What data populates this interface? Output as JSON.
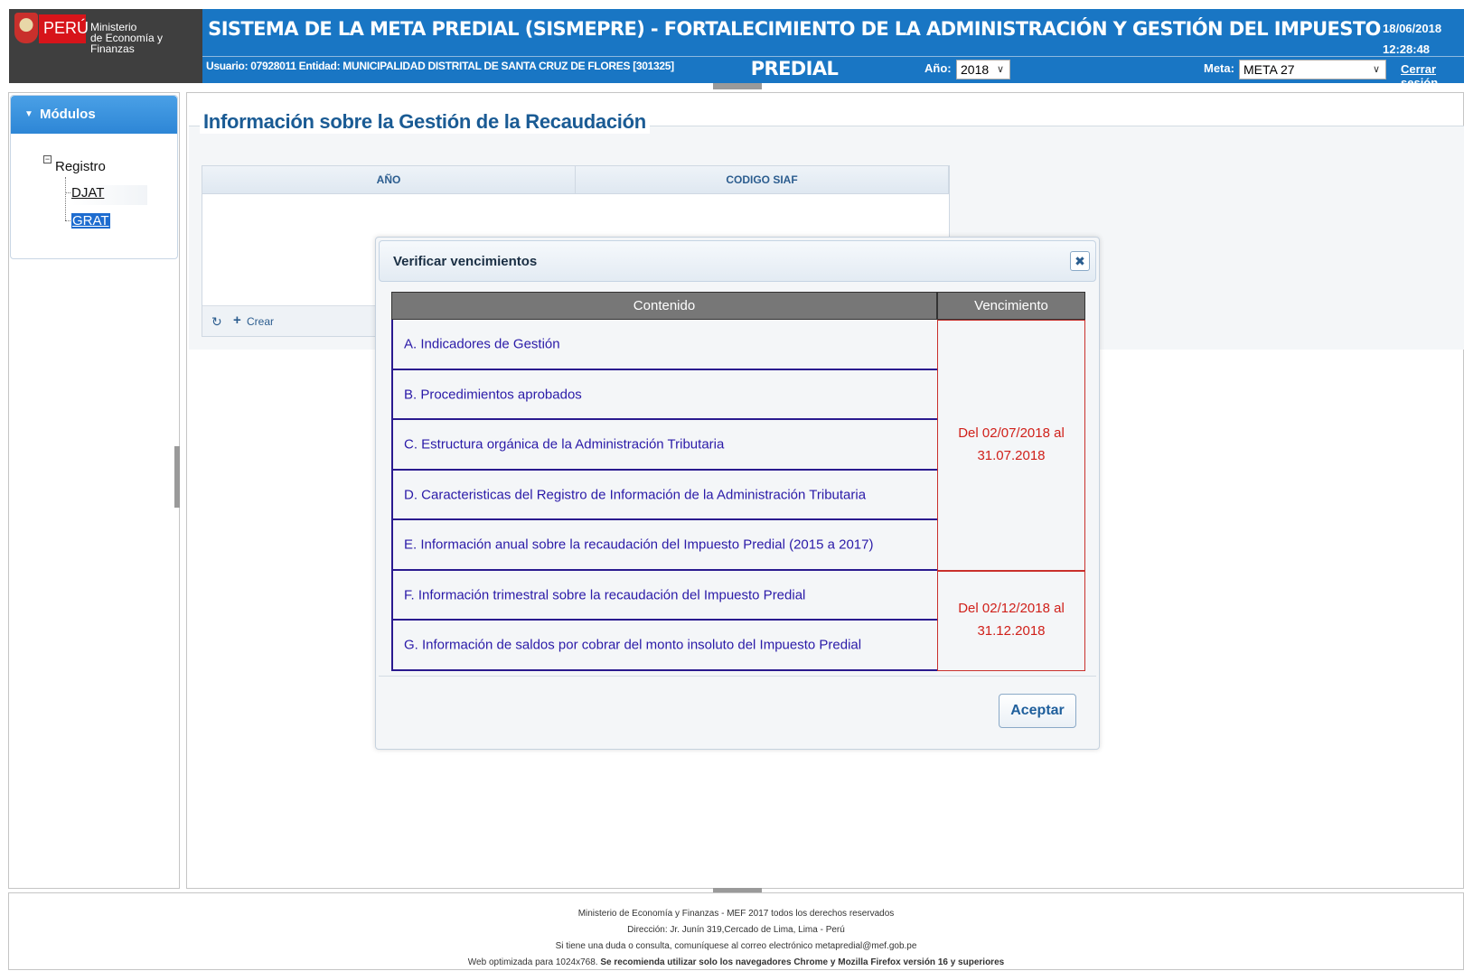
{
  "header": {
    "logo": {
      "country": "PERÚ",
      "ministry_line1": "Ministerio",
      "ministry_line2": "de Economía y Finanzas"
    },
    "title": "SISTEMA DE LA META PREDIAL (SISMEPRE) - FORTALECIMIENTO DE LA ADMINISTRACIÓN Y GESTIÓN DEL IMPUESTO PREDIAL",
    "date": "18/06/2018",
    "time": "12:28:48",
    "user_info": "Usuario: 07928011   Entidad: MUNICIPALIDAD DISTRITAL DE SANTA CRUZ DE FLORES [301325]",
    "year_label": "Año:",
    "year_value": "2018",
    "meta_label": "Meta:",
    "meta_value": "META 27",
    "logout_label": "Cerrar sesión"
  },
  "sidebar": {
    "modules_label": "Módulos",
    "tree": {
      "root_label": "Registro",
      "items": [
        {
          "label": "DJAT",
          "selected": false
        },
        {
          "label": "GRAT",
          "selected": true
        }
      ]
    }
  },
  "main": {
    "title": "Información sobre la Gestión de la Recaudación",
    "grid": {
      "columns": [
        "AÑO",
        "CODIGO SIAF"
      ],
      "create_label": "Crear"
    }
  },
  "modal": {
    "title": "Verificar vencimientos",
    "close_icon": "close-icon",
    "table_headers": {
      "content": "Contenido",
      "due": "Vencimiento"
    },
    "rows": [
      "A. Indicadores de Gestión",
      "B. Procedimientos aprobados",
      "C. Estructura orgánica de la Administración Tributaria",
      "D. Caracteristicas del Registro de Información de la Administración Tributaria",
      "E. Información anual sobre la recaudación del Impuesto Predial (2015 a 2017)",
      "F. Información trimestral sobre la recaudación del Impuesto Predial",
      "G. Información de saldos por cobrar del monto insoluto del Impuesto Predial"
    ],
    "due_groups": [
      {
        "line1": "Del 02/07/2018 al",
        "line2": "31.07.2018"
      },
      {
        "line1": "Del 02/12/2018 al",
        "line2": "31.12.2018"
      }
    ],
    "accept_label": "Aceptar"
  },
  "footer": {
    "line1": "Ministerio de Economía y Finanzas - MEF 2017 todos los derechos reservados",
    "line2": "Dirección: Jr. Junín 319,Cercado de Lima, Lima - Perú",
    "line3": "Si tiene una duda o consulta, comuníquese al correo electrónico metapredial@mef.gob.pe",
    "line4_normal": "Web optimizada para 1024x768.",
    "line4_bold": "Se recomienda utilizar solo los navegadores Chrome y Mozilla Firefox versión 16 y superiores"
  },
  "colors": {
    "header_blue": "#1976c4",
    "title_blue": "#1a5b94",
    "link_blue": "#2a1aa8",
    "due_red": "#d0201a"
  }
}
